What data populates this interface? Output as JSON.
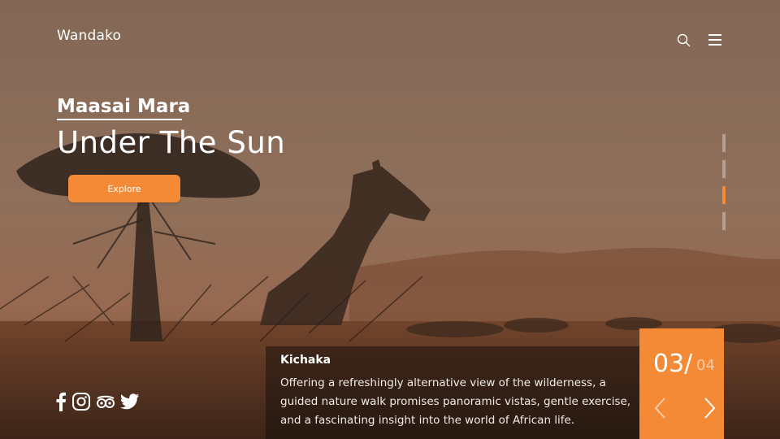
{
  "brand": {
    "name": "Wandako"
  },
  "header": {
    "search_icon": "search-icon",
    "menu_icon": "hamburger-menu-icon"
  },
  "hero": {
    "subtitle": "Maasai Mara",
    "title": "Under The Sun",
    "cta_label": "Explore"
  },
  "pager": {
    "count": 4,
    "active_index": 3
  },
  "social": {
    "icons": [
      "facebook-icon",
      "instagram-icon",
      "tripadvisor-icon",
      "twitter-icon"
    ]
  },
  "caption": {
    "title": "Kichaka",
    "text": "Offering a refreshingly alternative view of the wilderness, a guided nature walk promises panoramic vistas, gentle exercise, and a fascinating insight into the world of African life."
  },
  "counter": {
    "current": "03/",
    "total": "04"
  },
  "colors": {
    "accent": "#f48a35",
    "overlay": "#5a3f2e"
  }
}
